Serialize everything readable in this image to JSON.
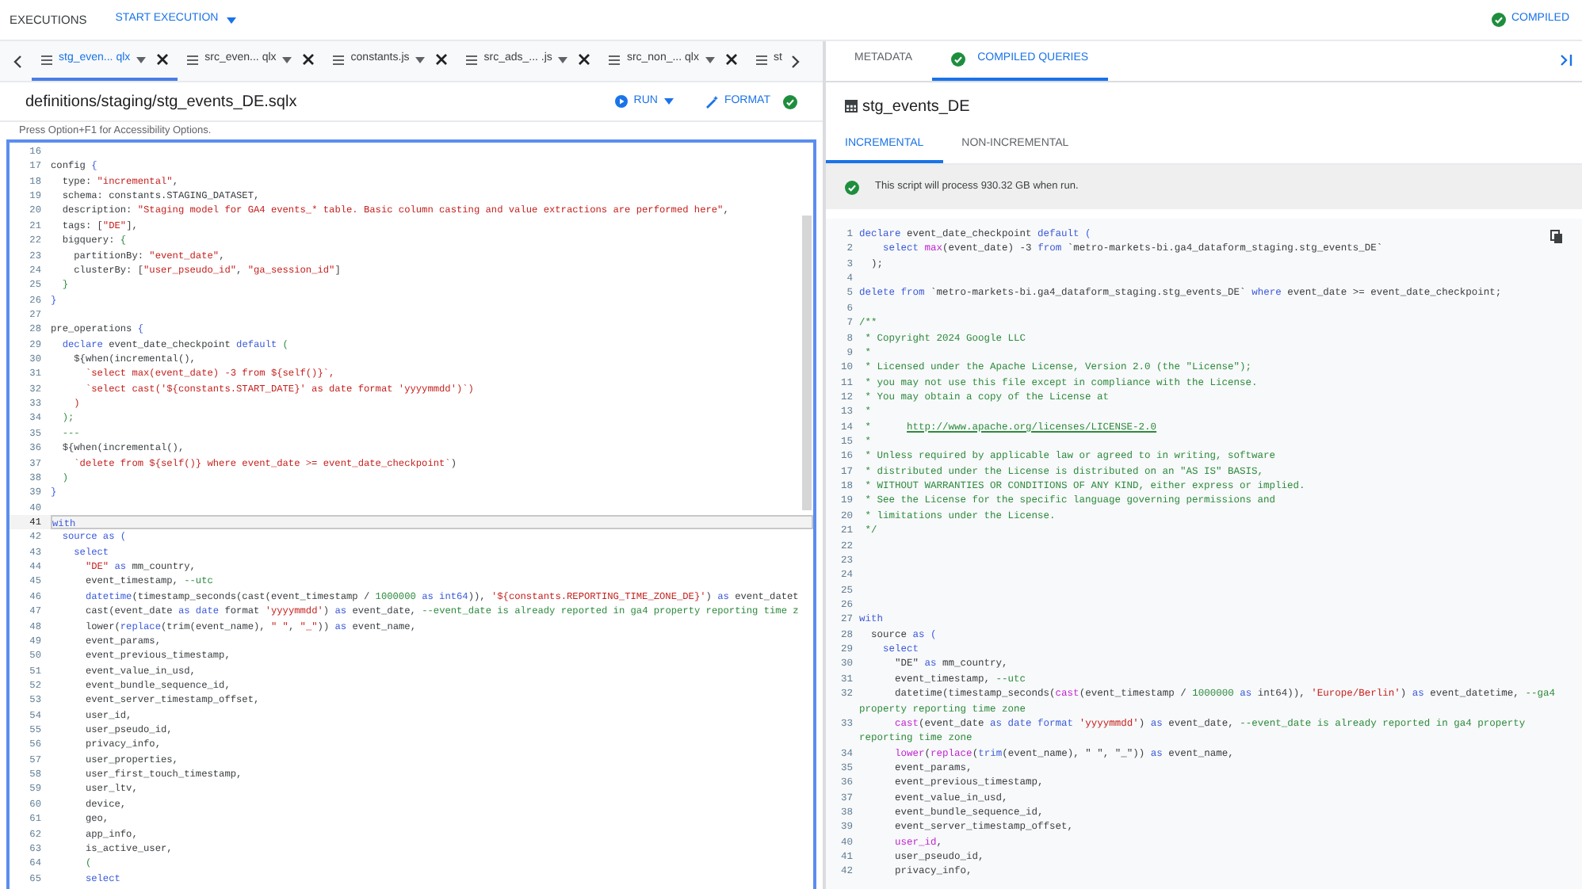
{
  "top_bar": {
    "executions": "EXECUTIONS",
    "start_execution": "START EXECUTION",
    "status": "COMPILED"
  },
  "file_tabs": [
    {
      "label": "stg_even... qlx",
      "selected": true,
      "kind": "full"
    },
    {
      "label": "src_even... qlx",
      "selected": false,
      "kind": "full"
    },
    {
      "label": "constants.js",
      "selected": false,
      "kind": "full"
    },
    {
      "label": "src_ads_... .js",
      "selected": false,
      "kind": "full"
    },
    {
      "label": "src_non_... qlx",
      "selected": false,
      "kind": "full"
    },
    {
      "label": "st",
      "selected": false,
      "kind": "partial"
    }
  ],
  "file_path": "definitions/staging/stg_events_DE.sqlx",
  "run_button": "RUN",
  "format_button": "FORMAT",
  "accessibility_hint": "Press Option+F1 for Accessibility Options.",
  "editor_lines": [
    {
      "n": "16",
      "current": false
    },
    {
      "n": "17",
      "current": false,
      "segs": [
        {
          "text": "config ",
          "kind": "p"
        },
        {
          "text": "{",
          "kind": "k"
        }
      ]
    },
    {
      "n": "18",
      "current": false,
      "segs": [
        {
          "text": "  type: ",
          "kind": "p"
        },
        {
          "text": "\"incremental\"",
          "kind": "s"
        },
        {
          "text": ",",
          "kind": "p"
        }
      ]
    },
    {
      "n": "19",
      "current": false,
      "segs": [
        {
          "text": "  schema: constants.STAGING_DATASET,",
          "kind": "p"
        }
      ]
    },
    {
      "n": "20",
      "current": false,
      "segs": [
        {
          "text": "  description: ",
          "kind": "p"
        },
        {
          "text": "\"Staging model for GA4 events_* table. Basic column casting and value extractions are performed here\"",
          "kind": "s"
        },
        {
          "text": ",",
          "kind": "p"
        }
      ]
    },
    {
      "n": "21",
      "current": false,
      "segs": [
        {
          "text": "  tags: [",
          "kind": "p"
        },
        {
          "text": "\"DE\"",
          "kind": "s"
        },
        {
          "text": "],",
          "kind": "p"
        }
      ]
    },
    {
      "n": "22",
      "current": false,
      "segs": [
        {
          "text": "  bigquery: ",
          "kind": "p"
        },
        {
          "text": "{",
          "kind": "c"
        }
      ]
    },
    {
      "n": "23",
      "current": false,
      "segs": [
        {
          "text": "    partitionBy: ",
          "kind": "p"
        },
        {
          "text": "\"event_date\"",
          "kind": "s"
        },
        {
          "text": ",",
          "kind": "p"
        }
      ]
    },
    {
      "n": "24",
      "current": false,
      "segs": [
        {
          "text": "    clusterBy: [",
          "kind": "p"
        },
        {
          "text": "\"user_pseudo_id\"",
          "kind": "s"
        },
        {
          "text": ", ",
          "kind": "p"
        },
        {
          "text": "\"ga_session_id\"",
          "kind": "s"
        },
        {
          "text": "]",
          "kind": "p"
        }
      ]
    },
    {
      "n": "25",
      "current": false,
      "segs": [
        {
          "text": "  }",
          "kind": "c"
        }
      ]
    },
    {
      "n": "26",
      "current": false,
      "segs": [
        {
          "text": "}",
          "kind": "k"
        }
      ]
    },
    {
      "n": "27",
      "current": false
    },
    {
      "n": "28",
      "current": false,
      "segs": [
        {
          "text": "pre_operations ",
          "kind": "p"
        },
        {
          "text": "{",
          "kind": "k"
        }
      ]
    },
    {
      "n": "29",
      "current": false,
      "segs": [
        {
          "text": "  declare",
          "kind": "k"
        },
        {
          "text": " event_date_checkpoint ",
          "kind": "p"
        },
        {
          "text": "default",
          "kind": "k"
        },
        {
          "text": " (",
          "kind": "c"
        }
      ]
    },
    {
      "n": "30",
      "current": false,
      "segs": [
        {
          "text": "    ${when(incremental(),",
          "kind": "p"
        }
      ]
    },
    {
      "n": "31",
      "current": false,
      "segs": [
        {
          "text": "      `select max(event_date) -3 from ${self()}`,",
          "kind": "s"
        }
      ]
    },
    {
      "n": "32",
      "current": false,
      "segs": [
        {
          "text": "      `select cast('${constants.START_DATE}' as date format 'yyyymmdd')`)",
          "kind": "s"
        }
      ]
    },
    {
      "n": "33",
      "current": false,
      "segs": [
        {
          "text": "    )",
          "kind": "s"
        }
      ]
    },
    {
      "n": "34",
      "current": false,
      "segs": [
        {
          "text": "  );",
          "kind": "c"
        }
      ]
    },
    {
      "n": "35",
      "current": false,
      "segs": [
        {
          "text": "  ---",
          "kind": "c"
        }
      ]
    },
    {
      "n": "36",
      "current": false,
      "segs": [
        {
          "text": "  ${when(incremental(),",
          "kind": "p"
        }
      ]
    },
    {
      "n": "37",
      "current": false,
      "segs": [
        {
          "text": "    `delete from ${self()} where event_date >= event_date_checkpoint`",
          "kind": "s"
        },
        {
          "text": ")",
          "kind": "p"
        }
      ]
    },
    {
      "n": "38",
      "current": false,
      "segs": [
        {
          "text": "  )",
          "kind": "c"
        }
      ]
    },
    {
      "n": "39",
      "current": false,
      "segs": [
        {
          "text": "}",
          "kind": "k"
        }
      ]
    },
    {
      "n": "40",
      "current": false
    },
    {
      "n": "41",
      "current": true,
      "segs": [
        {
          "text": "with",
          "kind": "k"
        }
      ]
    },
    {
      "n": "42",
      "current": false,
      "segs": [
        {
          "text": "  source as (",
          "kind": "k"
        }
      ]
    },
    {
      "n": "43",
      "current": false,
      "segs": [
        {
          "text": "    select",
          "kind": "k"
        }
      ]
    },
    {
      "n": "44",
      "current": false,
      "segs": [
        {
          "text": "      \"DE\"",
          "kind": "s"
        },
        {
          "text": " as",
          "kind": "k"
        },
        {
          "text": " mm_country,",
          "kind": "p"
        }
      ]
    },
    {
      "n": "45",
      "current": false,
      "segs": [
        {
          "text": "      event_timestamp, ",
          "kind": "p"
        },
        {
          "text": "--utc",
          "kind": "c"
        }
      ]
    },
    {
      "n": "46",
      "current": false,
      "segs": [
        {
          "text": "      datetime",
          "kind": "k"
        },
        {
          "text": "(timestamp_seconds(cast(event_timestamp / ",
          "kind": "p"
        },
        {
          "text": "1000000",
          "kind": "c"
        },
        {
          "text": " as int64",
          "kind": "k"
        },
        {
          "text": ")), ",
          "kind": "p"
        },
        {
          "text": "'${constants.REPORTING_TIME_ZONE_DE}'",
          "kind": "s"
        },
        {
          "text": ") ",
          "kind": "p"
        },
        {
          "text": "as",
          "kind": "k"
        },
        {
          "text": " event_datet",
          "kind": "p"
        }
      ]
    },
    {
      "n": "47",
      "current": false,
      "segs": [
        {
          "text": "      cast(event_date ",
          "kind": "p"
        },
        {
          "text": "as date",
          "kind": "k"
        },
        {
          "text": " format ",
          "kind": "p"
        },
        {
          "text": "'yyyymmdd'",
          "kind": "s"
        },
        {
          "text": ") ",
          "kind": "p"
        },
        {
          "text": "as",
          "kind": "k"
        },
        {
          "text": " event_date, ",
          "kind": "p"
        },
        {
          "text": "--event_date is already reported in ga4 property reporting time z",
          "kind": "c"
        }
      ]
    },
    {
      "n": "48",
      "current": false,
      "segs": [
        {
          "text": "      lower(",
          "kind": "p"
        },
        {
          "text": "replace",
          "kind": "k"
        },
        {
          "text": "(trim(event_name), ",
          "kind": "p"
        },
        {
          "text": "\" \"",
          "kind": "s"
        },
        {
          "text": ", ",
          "kind": "p"
        },
        {
          "text": "\"_\"",
          "kind": "s"
        },
        {
          "text": ")) ",
          "kind": "p"
        },
        {
          "text": "as",
          "kind": "k"
        },
        {
          "text": " event_name,",
          "kind": "p"
        }
      ]
    },
    {
      "n": "49",
      "current": false,
      "segs": [
        {
          "text": "      event_params,",
          "kind": "p"
        }
      ]
    },
    {
      "n": "50",
      "current": false,
      "segs": [
        {
          "text": "      event_previous_timestamp,",
          "kind": "p"
        }
      ]
    },
    {
      "n": "51",
      "current": false,
      "segs": [
        {
          "text": "      event_value_in_usd,",
          "kind": "p"
        }
      ]
    },
    {
      "n": "52",
      "current": false,
      "segs": [
        {
          "text": "      event_bundle_sequence_id,",
          "kind": "p"
        }
      ]
    },
    {
      "n": "53",
      "current": false,
      "segs": [
        {
          "text": "      event_server_timestamp_offset,",
          "kind": "p"
        }
      ]
    },
    {
      "n": "54",
      "current": false,
      "segs": [
        {
          "text": "      user_id,",
          "kind": "p"
        }
      ]
    },
    {
      "n": "55",
      "current": false,
      "segs": [
        {
          "text": "      user_pseudo_id,",
          "kind": "p"
        }
      ]
    },
    {
      "n": "56",
      "current": false,
      "segs": [
        {
          "text": "      privacy_info,",
          "kind": "p"
        }
      ]
    },
    {
      "n": "57",
      "current": false,
      "segs": [
        {
          "text": "      user_properties,",
          "kind": "p"
        }
      ]
    },
    {
      "n": "58",
      "current": false,
      "segs": [
        {
          "text": "      user_first_touch_timestamp,",
          "kind": "p"
        }
      ]
    },
    {
      "n": "59",
      "current": false,
      "segs": [
        {
          "text": "      user_ltv,",
          "kind": "p"
        }
      ]
    },
    {
      "n": "60",
      "current": false,
      "segs": [
        {
          "text": "      device,",
          "kind": "p"
        }
      ]
    },
    {
      "n": "61",
      "current": false,
      "segs": [
        {
          "text": "      geo,",
          "kind": "p"
        }
      ]
    },
    {
      "n": "62",
      "current": false,
      "segs": [
        {
          "text": "      app_info,",
          "kind": "p"
        }
      ]
    },
    {
      "n": "63",
      "current": false,
      "segs": [
        {
          "text": "      is_active_user,",
          "kind": "p"
        }
      ]
    },
    {
      "n": "64",
      "current": false,
      "segs": [
        {
          "text": "      (",
          "kind": "c"
        }
      ]
    },
    {
      "n": "65",
      "current": false,
      "segs": [
        {
          "text": "      select",
          "kind": "k"
        }
      ]
    }
  ],
  "panel_tabs": [
    {
      "label": "METADATA",
      "selected": false,
      "checked": false
    },
    {
      "label": "COMPILED QUERIES",
      "selected": true,
      "checked": true
    }
  ],
  "query_title": "stg_events_DE",
  "query_tabs": [
    {
      "label": "INCREMENTAL",
      "selected": true
    },
    {
      "label": "NON-INCREMENTAL",
      "selected": false
    }
  ],
  "estimate_message": "This script will process 930.32 GB when run.",
  "compiled_lines": [
    {
      "n": "1",
      "segs": [
        {
          "text": "declare",
          "kind": "k"
        },
        {
          "text": " event_date_checkpoint ",
          "kind": "p"
        },
        {
          "text": "default",
          "kind": "k"
        },
        {
          "text": " (",
          "kind": "k"
        }
      ]
    },
    {
      "n": "2",
      "segs": [
        {
          "text": "    select",
          "kind": "k"
        },
        {
          "text": " max",
          "kind": "f"
        },
        {
          "text": "(event_date) -3 ",
          "kind": "p"
        },
        {
          "text": "from",
          "kind": "k"
        },
        {
          "text": " `metro-markets-bi.ga4_dataform_staging.stg_events_DE`",
          "kind": "p"
        }
      ]
    },
    {
      "n": "3",
      "segs": [
        {
          "text": "  );",
          "kind": "p"
        }
      ]
    },
    {
      "n": "4"
    },
    {
      "n": "5",
      "segs": [
        {
          "text": "delete from",
          "kind": "k"
        },
        {
          "text": " `metro-markets-bi.ga4_dataform_staging.stg_events_DE` ",
          "kind": "p"
        },
        {
          "text": "where",
          "kind": "k"
        },
        {
          "text": " event_date >= event_date_checkpoint;",
          "kind": "p"
        }
      ]
    },
    {
      "n": "6"
    },
    {
      "n": "7",
      "segs": [
        {
          "text": "/**",
          "kind": "c"
        }
      ]
    },
    {
      "n": "8",
      "segs": [
        {
          "text": " * Copyright 2024 Google LLC",
          "kind": "c"
        }
      ]
    },
    {
      "n": "9",
      "segs": [
        {
          "text": " *",
          "kind": "c"
        }
      ]
    },
    {
      "n": "10",
      "segs": [
        {
          "text": " * Licensed under the Apache License, Version 2.0 (the \"License\");",
          "kind": "c"
        }
      ]
    },
    {
      "n": "11",
      "segs": [
        {
          "text": " * you may not use this file except in compliance with the License.",
          "kind": "c"
        }
      ]
    },
    {
      "n": "12",
      "segs": [
        {
          "text": " * You may obtain a copy of the License at",
          "kind": "c"
        }
      ]
    },
    {
      "n": "13",
      "segs": [
        {
          "text": " *",
          "kind": "c"
        }
      ]
    },
    {
      "n": "14",
      "segs": [
        {
          "text": " *      ",
          "kind": "c"
        },
        {
          "text": "http://www.apache.org/licenses/LICENSE-2.0",
          "kind": "u"
        }
      ]
    },
    {
      "n": "15",
      "segs": [
        {
          "text": " *",
          "kind": "c"
        }
      ]
    },
    {
      "n": "16",
      "segs": [
        {
          "text": " * Unless required by applicable law or agreed to in writing, software",
          "kind": "c"
        }
      ]
    },
    {
      "n": "17",
      "segs": [
        {
          "text": " * distributed under the License is distributed on an \"AS IS\" BASIS,",
          "kind": "c"
        }
      ]
    },
    {
      "n": "18",
      "segs": [
        {
          "text": " * WITHOUT WARRANTIES OR CONDITIONS OF ANY KIND, either express or implied.",
          "kind": "c"
        }
      ]
    },
    {
      "n": "19",
      "segs": [
        {
          "text": " * See the License for the specific language governing permissions and",
          "kind": "c"
        }
      ]
    },
    {
      "n": "20",
      "segs": [
        {
          "text": " * limitations under the License.",
          "kind": "c"
        }
      ]
    },
    {
      "n": "21",
      "segs": [
        {
          "text": " */",
          "kind": "c"
        }
      ]
    },
    {
      "n": "22"
    },
    {
      "n": "23"
    },
    {
      "n": "24"
    },
    {
      "n": "25"
    },
    {
      "n": "26"
    },
    {
      "n": "27",
      "segs": [
        {
          "text": "with",
          "kind": "k"
        }
      ]
    },
    {
      "n": "28",
      "segs": [
        {
          "text": "  source ",
          "kind": "p"
        },
        {
          "text": "as (",
          "kind": "k"
        }
      ]
    },
    {
      "n": "29",
      "segs": [
        {
          "text": "    select",
          "kind": "k"
        }
      ]
    },
    {
      "n": "30",
      "segs": [
        {
          "text": "      \"DE\"",
          "kind": "p"
        },
        {
          "text": " as",
          "kind": "k"
        },
        {
          "text": " mm_country,",
          "kind": "p"
        }
      ]
    },
    {
      "n": "31",
      "segs": [
        {
          "text": "      event_timestamp, ",
          "kind": "p"
        },
        {
          "text": "--utc",
          "kind": "c"
        }
      ]
    },
    {
      "n": "32",
      "segs": [
        {
          "text": "      datetime(timestamp_seconds(",
          "kind": "p"
        },
        {
          "text": "cast",
          "kind": "f"
        },
        {
          "text": "(event_timestamp / ",
          "kind": "p"
        },
        {
          "text": "1000000",
          "kind": "c"
        },
        {
          "text": " as",
          "kind": "k"
        },
        {
          "text": " int64)), ",
          "kind": "p"
        },
        {
          "text": "'Europe/Berlin'",
          "kind": "s"
        },
        {
          "text": ") ",
          "kind": "p"
        },
        {
          "text": "as",
          "kind": "k"
        },
        {
          "text": " event_datetime, ",
          "kind": "p"
        },
        {
          "text": "--ga4 property reporting time zone",
          "kind": "c"
        }
      ]
    },
    {
      "n": "33",
      "segs": [
        {
          "text": "      cast",
          "kind": "f"
        },
        {
          "text": "(event_date ",
          "kind": "p"
        },
        {
          "text": "as date format",
          "kind": "k"
        },
        {
          "text": " 'yyyymmdd'",
          "kind": "s"
        },
        {
          "text": ") ",
          "kind": "p"
        },
        {
          "text": "as",
          "kind": "k"
        },
        {
          "text": " event_date, ",
          "kind": "p"
        },
        {
          "text": "--event_date is already reported in ga4 property reporting time zone",
          "kind": "c"
        }
      ]
    },
    {
      "n": "34",
      "segs": [
        {
          "text": "      lower",
          "kind": "f"
        },
        {
          "text": "(",
          "kind": "p"
        },
        {
          "text": "replace",
          "kind": "f"
        },
        {
          "text": "(",
          "kind": "p"
        },
        {
          "text": "trim",
          "kind": "k"
        },
        {
          "text": "(event_name), \" \", \"_\")) ",
          "kind": "p"
        },
        {
          "text": "as",
          "kind": "k"
        },
        {
          "text": " event_name,",
          "kind": "p"
        }
      ]
    },
    {
      "n": "35",
      "segs": [
        {
          "text": "      event_params,",
          "kind": "p"
        }
      ]
    },
    {
      "n": "36",
      "segs": [
        {
          "text": "      event_previous_timestamp,",
          "kind": "p"
        }
      ]
    },
    {
      "n": "37",
      "segs": [
        {
          "text": "      event_value_in_usd,",
          "kind": "p"
        }
      ]
    },
    {
      "n": "38",
      "segs": [
        {
          "text": "      event_bundle_sequence_id,",
          "kind": "p"
        }
      ]
    },
    {
      "n": "39",
      "segs": [
        {
          "text": "      event_server_timestamp_offset,",
          "kind": "p"
        }
      ]
    },
    {
      "n": "40",
      "segs": [
        {
          "text": "      user_id",
          "kind": "f"
        },
        {
          "text": ",",
          "kind": "p"
        }
      ]
    },
    {
      "n": "41",
      "segs": [
        {
          "text": "      user_pseudo_id,",
          "kind": "p"
        }
      ]
    },
    {
      "n": "42",
      "segs": [
        {
          "text": "      privacy_info,",
          "kind": "p"
        }
      ]
    }
  ]
}
